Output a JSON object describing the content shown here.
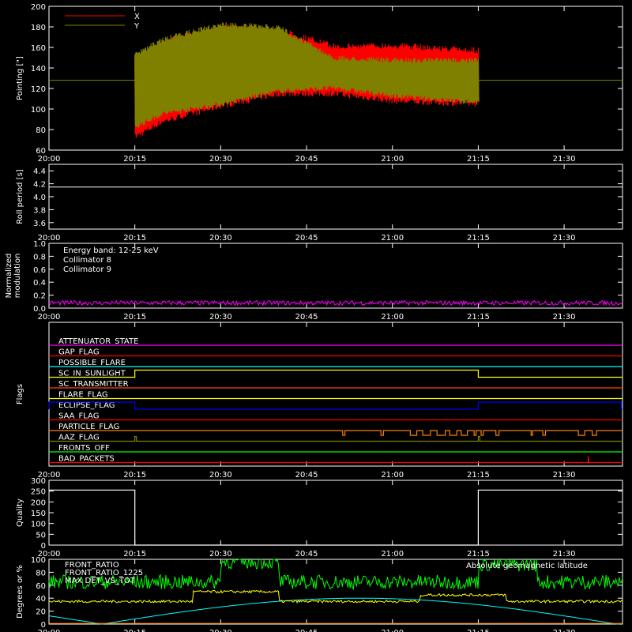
{
  "chart_data": [
    {
      "type": "line",
      "ylabel": "Pointing [\"]",
      "ylim": [
        60,
        200
      ],
      "yticks": [
        60,
        80,
        100,
        120,
        140,
        160,
        180,
        200
      ],
      "legend": [
        "X",
        "Y"
      ],
      "legend_placement": "top-left",
      "series": [
        {
          "name": "X",
          "color": "#ff0000",
          "x_start": "20:15",
          "x_end": "21:15",
          "upper": [
            [
              20.25,
              150
            ],
            [
              20.33,
              168
            ],
            [
              20.5,
              182
            ],
            [
              20.67,
              180
            ],
            [
              20.83,
              164
            ],
            [
              21.0,
              165
            ],
            [
              21.25,
              160
            ]
          ],
          "lower": [
            [
              20.25,
              70
            ],
            [
              20.33,
              85
            ],
            [
              20.5,
              100
            ],
            [
              20.67,
              112
            ],
            [
              20.83,
              112
            ],
            [
              21.0,
              105
            ],
            [
              21.25,
              102
            ]
          ]
        },
        {
          "name": "Y",
          "color": "#808000",
          "baseline": 128,
          "x_start": "20:15",
          "x_end": "21:15",
          "upper": [
            [
              20.25,
              155
            ],
            [
              20.33,
              170
            ],
            [
              20.5,
              185
            ],
            [
              20.67,
              182
            ],
            [
              20.83,
              152
            ],
            [
              21.0,
              150
            ],
            [
              21.25,
              150
            ]
          ],
          "lower": [
            [
              20.25,
              80
            ],
            [
              20.33,
              93
            ],
            [
              20.5,
              102
            ],
            [
              20.67,
              115
            ],
            [
              20.83,
              118
            ],
            [
              21.0,
              110
            ],
            [
              21.25,
              104
            ]
          ]
        }
      ]
    },
    {
      "type": "line",
      "ylabel": "Roll period [s]",
      "ylim": [
        3.5,
        4.5
      ],
      "yticks": [
        3.6,
        3.8,
        4.0,
        4.2,
        4.4
      ],
      "series": [
        {
          "color": "#ffffff",
          "values": [
            4.15
          ]
        }
      ]
    },
    {
      "type": "line",
      "ylabel_lines": [
        "Normalized",
        "modulation"
      ],
      "ylim": [
        0,
        1.0
      ],
      "yticks": [
        0.0,
        0.2,
        0.4,
        0.6,
        0.8,
        1.0
      ],
      "annotations": [
        "Energy band: 12-25 keV"
      ],
      "series": [
        {
          "name": "Collimator 8",
          "color": "#00ffff"
        },
        {
          "name": "Collimator 9",
          "color": "#ff00ff",
          "mean": 0.08
        }
      ]
    },
    {
      "type": "line",
      "ylabel": "Flags",
      "flags": [
        {
          "name": "ATTENUATOR_STATE",
          "color": "#ff00ff"
        },
        {
          "name": "GAP_FLAG",
          "color": "#ff0000"
        },
        {
          "name": "POSSIBLE_FLARE",
          "color": "#00ffff"
        },
        {
          "name": "SC_IN_SUNLIGHT",
          "color": "#ffff00",
          "high": [
            [
              "20:15",
              "21:15"
            ]
          ]
        },
        {
          "name": "SC_TRANSMITTER",
          "color": "#ff4000"
        },
        {
          "name": "FLARE_FLAG",
          "color": "#ffff00"
        },
        {
          "name": "ECLIPSE_FLAG",
          "color": "#0000ff",
          "high": [
            [
              "20:00",
              "20:15"
            ],
            [
              "21:15",
              "21:40"
            ]
          ]
        },
        {
          "name": "SAA_FLAG",
          "color": "#ff0000"
        },
        {
          "name": "PARTICLE_FLAG",
          "color": "#ff8000"
        },
        {
          "name": "AAZ_FLAG",
          "color": "#808000"
        },
        {
          "name": "FRONTS_OFF",
          "color": "#00ff00"
        },
        {
          "name": "BAD_PACKETS",
          "color": "#ff0000"
        }
      ]
    },
    {
      "type": "line",
      "ylabel": "Quality",
      "ylim": [
        0,
        300
      ],
      "yticks": [
        0,
        50,
        100,
        150,
        200,
        250,
        300
      ],
      "series": [
        {
          "color": "#ffffff",
          "values": [
            [
              20.0,
              255
            ],
            [
              20.25,
              255
            ],
            [
              20.25,
              0
            ],
            [
              21.25,
              0
            ],
            [
              21.25,
              255
            ],
            [
              21.67,
              255
            ]
          ]
        }
      ]
    },
    {
      "type": "line",
      "ylabel": "Degrees or %",
      "ylim": [
        0,
        100
      ],
      "yticks": [
        0,
        20,
        40,
        60,
        80,
        100
      ],
      "series": [
        {
          "name": "FRONT_RATIO",
          "color": "#ffff00"
        },
        {
          "name": "FRONT_RATIO_1225",
          "color": "#00ff00"
        },
        {
          "name": "MAX DET_VS_TOT",
          "color": "#ff8000"
        },
        {
          "name": "Absolute geomagnetic latitude",
          "color": "#00ffff"
        }
      ]
    }
  ],
  "x_axis": {
    "ticks": [
      "20:00",
      "20:15",
      "20:30",
      "20:45",
      "21:00",
      "21:15",
      "21:30"
    ],
    "range_hours": [
      20.0,
      21.67
    ]
  }
}
